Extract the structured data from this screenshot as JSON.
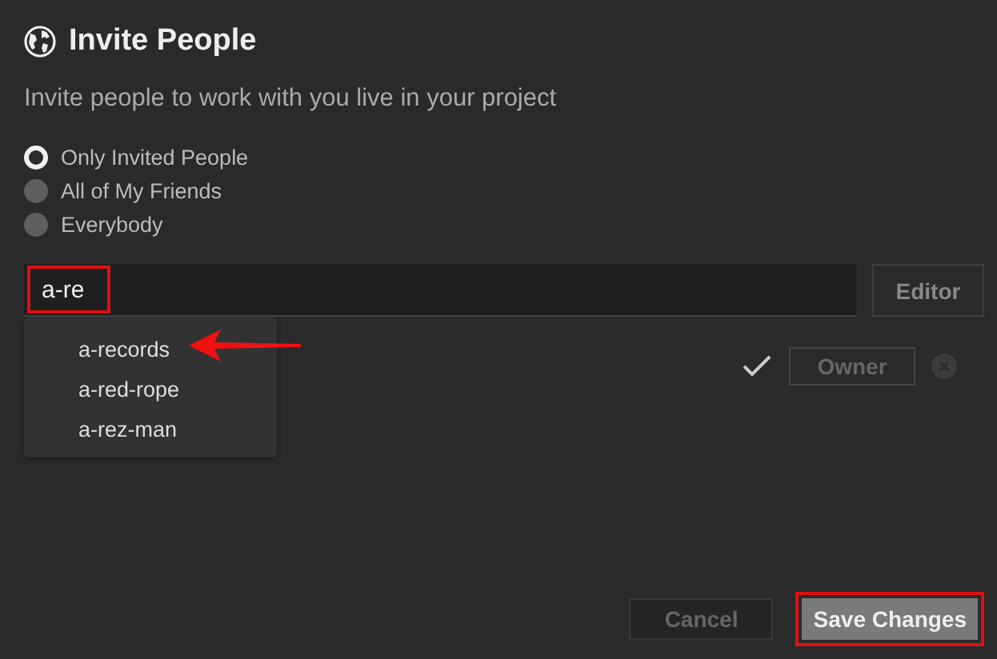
{
  "dialog": {
    "title": "Invite People",
    "subtitle": "Invite people to work with you live in your project"
  },
  "visibility_options": [
    {
      "label": "Only Invited People",
      "selected": true
    },
    {
      "label": "All of My Friends",
      "selected": false
    },
    {
      "label": "Everybody",
      "selected": false
    }
  ],
  "invite_field": {
    "value": "a-re",
    "highlighted": true
  },
  "role_button": {
    "label": "Editor"
  },
  "suggestions": [
    {
      "label": "a-records",
      "pointed": true
    },
    {
      "label": "a-red-rope",
      "pointed": false
    },
    {
      "label": "a-rez-man",
      "pointed": false
    }
  ],
  "member_row": {
    "role": "Owner",
    "disabled": true
  },
  "buttons": [
    {
      "label": "Cancel",
      "kind": "secondary",
      "highlighted": false
    },
    {
      "label": "Save Changes",
      "kind": "primary",
      "highlighted": true
    }
  ]
}
